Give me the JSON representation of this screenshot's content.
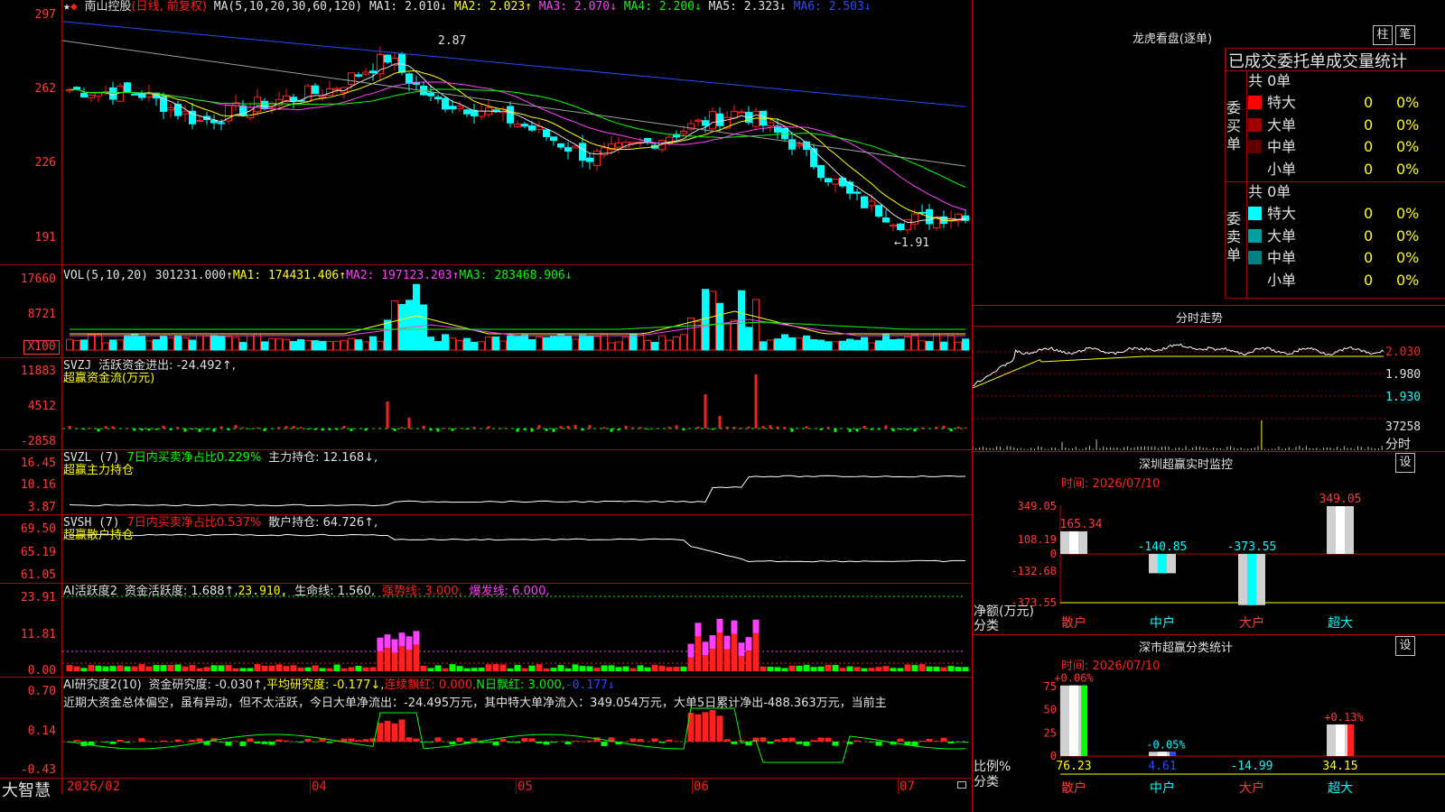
{
  "app": {
    "brand": "大智慧"
  },
  "colors": {
    "up": "#ff2020",
    "down": "#00ffff",
    "ma1": "#e0e0e0",
    "ma2": "#ffff00",
    "ma3": "#ff40ff",
    "ma4": "#00ff00",
    "ma5": "#a0a0a0",
    "ma6": "#2b4bff",
    "grid": "#a00000"
  },
  "price_panel": {
    "star": "★",
    "diamond": "◆",
    "stock": "南山控股",
    "mode": "(日线, 前复权)",
    "ma_label": "MA(5,10,20,30,60,120)",
    "ma1": "MA1: 2.010↓",
    "ma2": "MA2: 2.023↑",
    "ma3": "MA3: 2.070↓",
    "ma4": "MA4: 2.200↓",
    "ma5": "MA5: 2.323↓",
    "ma6": "MA6: 2.503↓",
    "y_ticks": [
      "297",
      "262",
      "226",
      "191"
    ],
    "high_mark": "2.87",
    "low_mark": "←1.91"
  },
  "vol_panel": {
    "label": "VOL(5,10,20)",
    "value": "301231.000↑",
    "ma1": "MA1: 174431.406↑",
    "ma2": "MA2: 197123.203↑",
    "ma3": "MA3: 283468.906↓",
    "y_ticks": [
      "17660",
      "8721",
      "X100"
    ]
  },
  "svzj_panel": {
    "label": "SVZJ",
    "text": "活跃资金进出: -24.492↑,",
    "sub": "超赢资金流(万元)",
    "y_ticks": [
      "11883",
      "4512",
      "-2858"
    ]
  },
  "svzl_panel": {
    "label": "SVZL (7)",
    "ratio": "7日内买卖净占比0.229%",
    "text": "主力持仓: 12.168↓,",
    "sub": "超赢主力持仓",
    "y_ticks": [
      "16.45",
      "10.16",
      "3.87"
    ]
  },
  "svsh_panel": {
    "label": "SVSH (7)",
    "ratio": "7日内买卖净占比0.537%",
    "text": "散户持仓: 64.726↑,",
    "sub": "超赢散户持仓",
    "y_ticks": [
      "69.50",
      "65.19",
      "61.05"
    ]
  },
  "ai_active_panel": {
    "label": "AI活跃度2",
    "text1": "资金活跃度: 1.688↑,",
    "text2": "23.910,",
    "text3": "生命线: 1.560,",
    "text4": "强势线: 3.000,",
    "text5": "爆发线: 6.000,",
    "y_ticks": [
      "23.91",
      "11.81",
      "0.00"
    ]
  },
  "ai_research_panel": {
    "label": "AI研究度2(10)",
    "text1": "资金研究度: -0.030↑,",
    "text2": "平均研究度: -0.177↓,",
    "text3": "连续飘红: 0.000,",
    "text4": "N日飘红: 3.000,",
    "text5": "-0.177↓",
    "comment": "近期大资金总体偏空，虽有异动，但不太活跃，今日大单净流出：-24.495万元，其中特大单净流入：349.054万元，大单5日累计净出-488.363万元，当前主",
    "y_ticks": [
      "0.70",
      "0.14",
      "-0.43"
    ]
  },
  "x_axis": [
    "2026/02",
    "04",
    "05",
    "06",
    "07"
  ],
  "right": {
    "dragon_title": "龙虎看盘(逐单)",
    "btn_zhu": "柱",
    "btn_bi": "笔",
    "stats_title": "已成交委托单成交量统计",
    "buy_label": "委买单",
    "sell_label": "委卖单",
    "buy_total": "共 0单",
    "sell_total": "共 0单",
    "buy_rows": [
      {
        "name": "特大",
        "color": "#ff0000",
        "qty": "0",
        "pct": "0%"
      },
      {
        "name": "大单",
        "color": "#a00000",
        "qty": "0",
        "pct": "0%"
      },
      {
        "name": "中单",
        "color": "#600000",
        "qty": "0",
        "pct": "0%"
      },
      {
        "name": "小单",
        "color": "#000000",
        "qty": "0",
        "pct": "0%"
      }
    ],
    "sell_rows": [
      {
        "name": "特大",
        "color": "#00ffff",
        "qty": "0",
        "pct": "0%"
      },
      {
        "name": "大单",
        "color": "#00a0a0",
        "qty": "0",
        "pct": "0%"
      },
      {
        "name": "中单",
        "color": "#008080",
        "qty": "0",
        "pct": "0%"
      },
      {
        "name": "小单",
        "color": "#000000",
        "qty": "0",
        "pct": "0%"
      }
    ],
    "minute_title": "分时走势",
    "minute_prices": [
      "2.030",
      "1.980",
      "1.930"
    ],
    "minute_vol": "37258",
    "minute_vol_label": "分时",
    "monitor_title": "深圳超赢实时监控",
    "monitor_btn": "设",
    "monitor_time": "时间: 2026/07/10",
    "monitor_y": [
      "349.05",
      "108.19",
      "0",
      "-132.68",
      "-373.55"
    ],
    "monitor_ylabel": "净额(万元)",
    "monitor_xlabel": "分类",
    "monitor_cats": [
      "散户",
      "中户",
      "大户",
      "超大"
    ],
    "monitor_values": [
      165.34,
      -140.85,
      -373.55,
      349.05
    ],
    "monitor_value_labels": [
      "165.34",
      "-140.85",
      "-373.55",
      "349.05"
    ],
    "class_title": "深市超赢分类统计",
    "class_btn": "设",
    "class_time": "时间: 2026/07/10",
    "class_y": [
      "75",
      "50",
      "25",
      "0"
    ],
    "class_ylabel": "比例%",
    "class_xlabel": "分类",
    "class_cats": [
      "散户",
      "中户",
      "大户",
      "超大"
    ],
    "class_values": [
      76.23,
      4.61,
      -14.99,
      34.15
    ],
    "class_bottom_labels": [
      "76.23",
      "4.61",
      "-14.99",
      "34.15"
    ],
    "class_top_labels": [
      "+0.06%",
      "-0.05%",
      "",
      "+0.13%"
    ]
  }
}
